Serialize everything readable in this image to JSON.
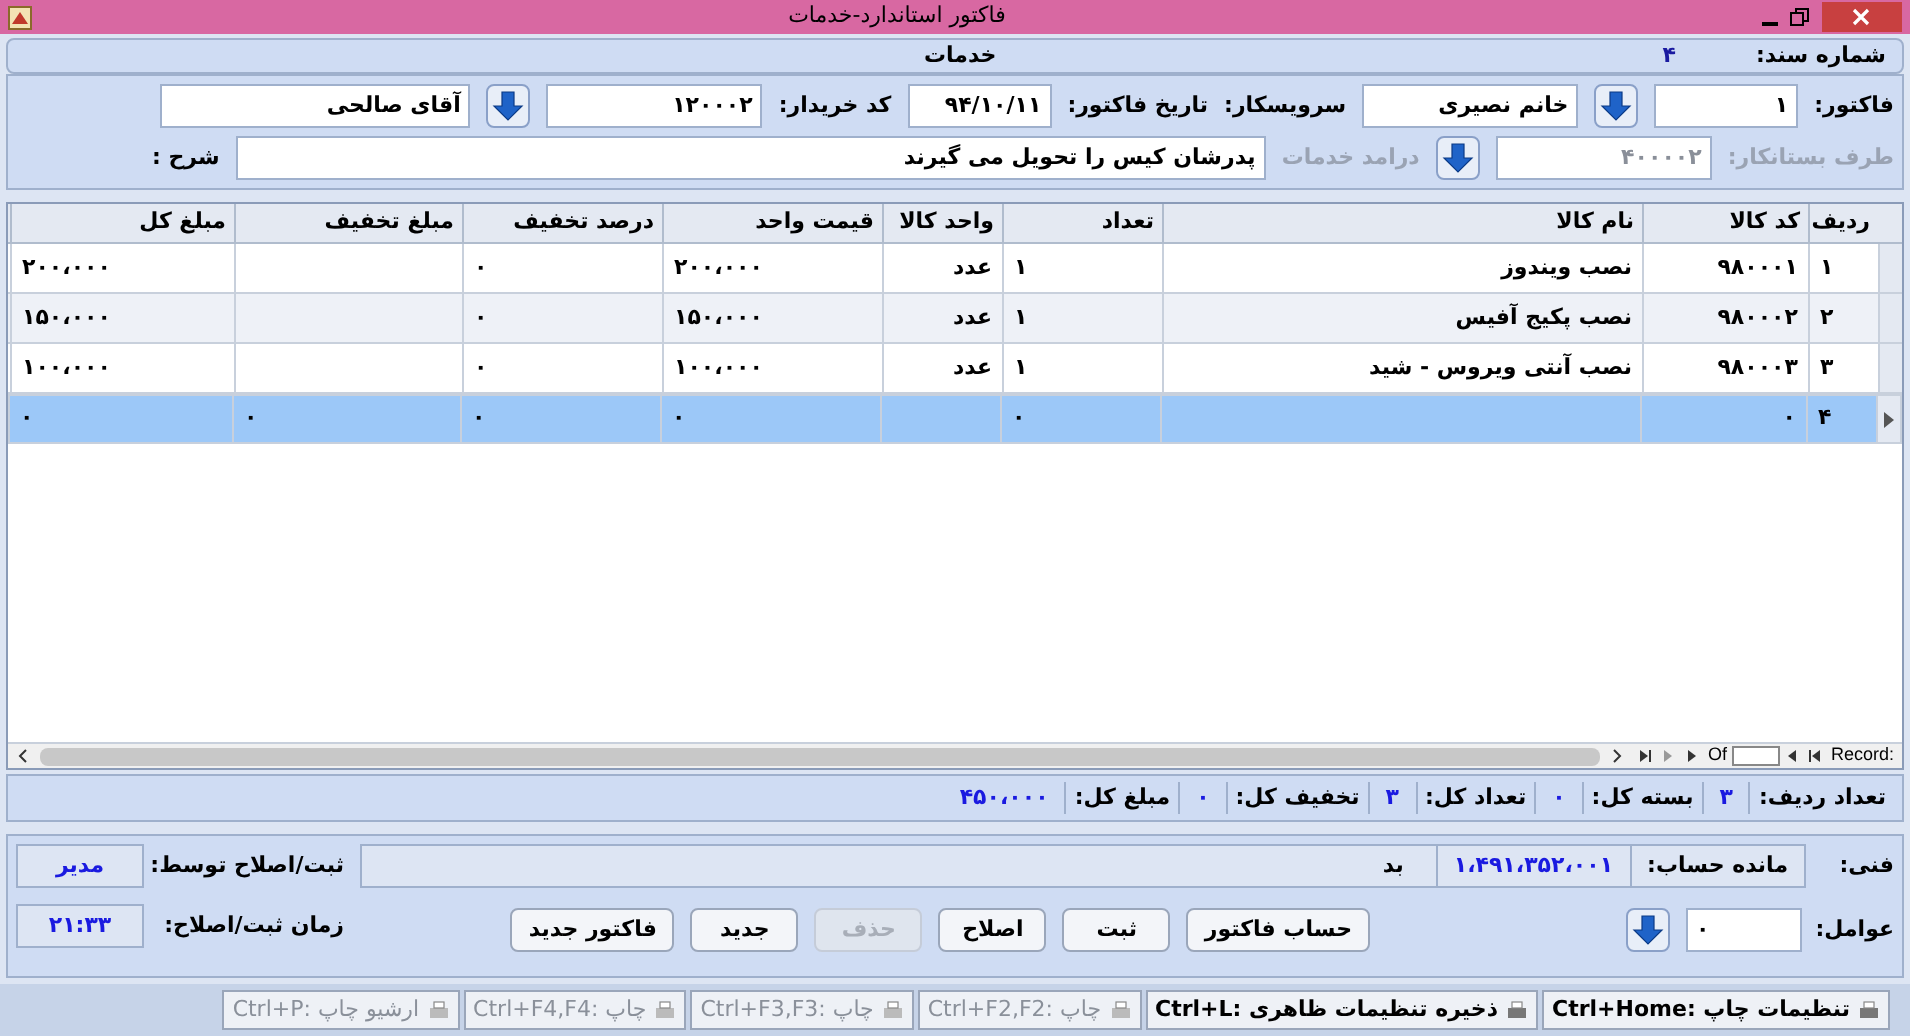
{
  "window": {
    "title": "فاکتور استاندارد-خدمات"
  },
  "header": {
    "doc_label": "شماره سند:",
    "doc_number": "۴",
    "section": "خدمات"
  },
  "form": {
    "row1": [
      {
        "kind": "label",
        "text": "فاکتور:"
      },
      {
        "kind": "field",
        "value": "۱"
      },
      {
        "kind": "lookup"
      },
      {
        "kind": "field",
        "value": "خانم نصیری"
      },
      {
        "kind": "label",
        "text": "سرویسکار:"
      },
      {
        "kind": "label",
        "text": "تاریخ فاکتور:"
      },
      {
        "kind": "field",
        "value": "۹۴/۱۰/۱۱"
      },
      {
        "kind": "label",
        "text": "کد خریدار:"
      },
      {
        "kind": "field",
        "value": "۱۲۰۰۰۲"
      },
      {
        "kind": "lookup"
      },
      {
        "kind": "field",
        "value": "آقای صالحی"
      }
    ],
    "row2": [
      {
        "kind": "label",
        "text": "طرف بستانکار:",
        "disabled": true
      },
      {
        "kind": "field",
        "value": "۴۰۰۰۰۲",
        "disabled": true
      },
      {
        "kind": "lookup"
      },
      {
        "kind": "label",
        "text": "درامد خدمات",
        "disabled": true
      },
      {
        "kind": "field",
        "value": "پدرشان کیس را تحویل می گیرند",
        "disabled": false
      },
      {
        "kind": "label",
        "text": "شرح :",
        "disabled": false
      }
    ]
  },
  "table": {
    "columns": [
      "ردیف",
      "کد کالا",
      "نام کالا",
      "تعداد",
      "واحد کالا",
      "قیمت واحد",
      "درصد تخفیف",
      "مبلغ تخفیف",
      "مبلغ کل"
    ],
    "rows": [
      {
        "selected": false,
        "cells": [
          "۱",
          "۹۸۰۰۰۱",
          "نصب ویندوز",
          "۱",
          "عدد",
          "۲۰۰،۰۰۰",
          "۰",
          null,
          "۲۰۰،۰۰۰"
        ]
      },
      {
        "selected": false,
        "cells": [
          "۲",
          "۹۸۰۰۰۲",
          "نصب پکیج آفیس",
          "۱",
          "عدد",
          "۱۵۰،۰۰۰",
          "۰",
          null,
          "۱۵۰،۰۰۰"
        ]
      },
      {
        "selected": false,
        "cells": [
          "۳",
          "۹۸۰۰۰۳",
          "نصب آنتی ویروس - شید",
          "۱",
          "عدد",
          "۱۰۰،۰۰۰",
          "۰",
          null,
          "۱۰۰،۰۰۰"
        ]
      },
      {
        "selected": true,
        "cells": [
          "۴",
          "۰",
          null,
          "۰",
          null,
          "۰",
          "۰",
          "۰",
          "۰"
        ]
      }
    ],
    "navigator": {
      "record_label": "Record:",
      "of_label": "Of"
    }
  },
  "summary": [
    {
      "label": "تعداد ردیف:",
      "value": "۳"
    },
    {
      "label": "بسته کل:",
      "value": "۰"
    },
    {
      "label": "تعداد کل:",
      "value": "۳"
    },
    {
      "label": "تخفیف کل:",
      "value": "۰"
    },
    {
      "label": "مبلغ کل:",
      "value": "۴۵۰،۰۰۰"
    }
  ],
  "footer": {
    "tech_label": "فنی:",
    "balance_label": "مانده حساب:",
    "balance_value": "۱،۴۹۱،۳۵۲،۰۰۱",
    "balance_status": "بد",
    "agents_label": "عوامل:",
    "agents_value": "۰",
    "edited_by_label": "ثبت/اصلاح توسط:",
    "edited_by": "مدیر",
    "edit_time_label": "زمان ثبت/اصلاح:",
    "edit_time": "۲۱:۳۳",
    "buttons": [
      {
        "label": "حساب فاکتور",
        "disabled": false
      },
      {
        "label": "ثبت",
        "disabled": false
      },
      {
        "label": "اصلاح",
        "disabled": false
      },
      {
        "label": "حذف",
        "disabled": true
      },
      {
        "label": "جدید",
        "disabled": false
      },
      {
        "label": "فاکتور جدید",
        "disabled": false
      }
    ]
  },
  "status_bar": [
    {
      "label": "تنظیمات چاپ :Ctrl+Home",
      "disabled": false
    },
    {
      "label": "ذخیره تنظیمات ظاهری :Ctrl+L",
      "disabled": false
    },
    {
      "label": "چاپ :Ctrl+F2,F2",
      "disabled": true
    },
    {
      "label": "چاپ :Ctrl+F3,F3",
      "disabled": true
    },
    {
      "label": "چاپ :Ctrl+F4,F4",
      "disabled": true
    },
    {
      "label": "ارشیو چاپ :Ctrl+P",
      "disabled": true
    }
  ]
}
